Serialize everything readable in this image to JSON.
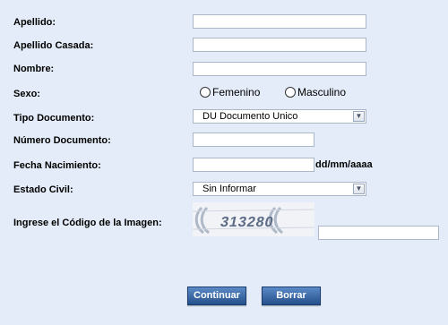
{
  "form": {
    "apellido_label": "Apellido:",
    "apellido_value": "",
    "apellido_casada_label": "Apellido Casada:",
    "apellido_casada_value": "",
    "nombre_label": "Nombre:",
    "nombre_value": "",
    "sexo_label": "Sexo:",
    "sexo_options": [
      "Femenino",
      "Masculino"
    ],
    "tipo_documento_label": "Tipo Documento:",
    "tipo_documento_value": "DU Documento Unico",
    "numero_documento_label": "Número Documento:",
    "numero_documento_value": "",
    "fecha_nacimiento_label": "Fecha Nacimiento:",
    "fecha_nacimiento_value": "",
    "fecha_format_hint": "dd/mm/aaaa",
    "estado_civil_label": "Estado Civil:",
    "estado_civil_value": "Sin Informar",
    "captcha_label": "Ingrese el Código de la Imagen:",
    "captcha_code": "313280",
    "captcha_input_value": ""
  },
  "buttons": {
    "continuar": "Continuar",
    "borrar": "Borrar"
  },
  "colors": {
    "background": "#e3ecf8",
    "button": "#2f5f9e"
  }
}
